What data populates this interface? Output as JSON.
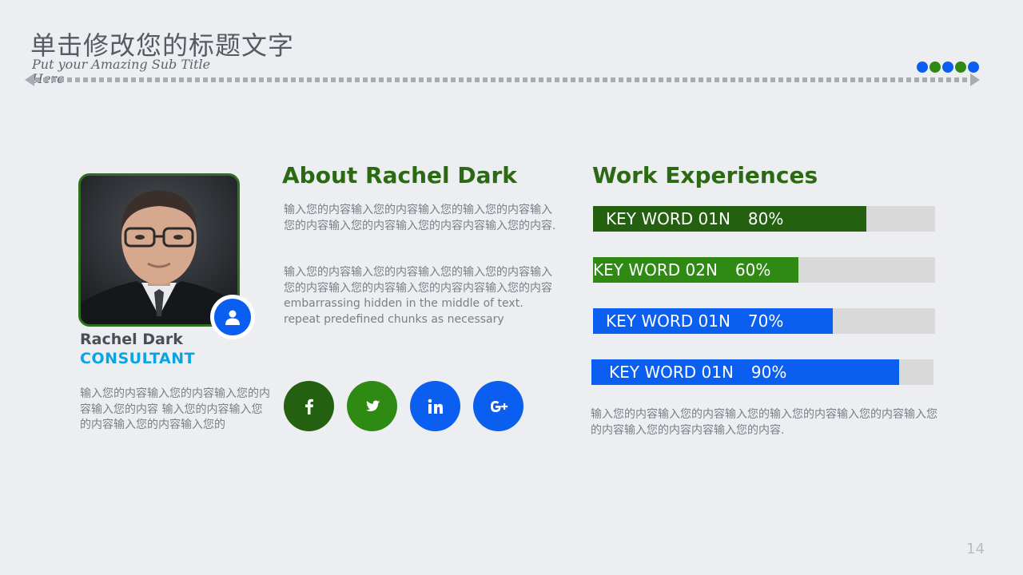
{
  "header": {
    "title": "单击修改您的标题文字",
    "subtitle": "Put your Amazing Sub Title Here"
  },
  "colors": {
    "dark_green": "#2b6a12",
    "green": "#2f8a14",
    "blue": "#0b5ff0",
    "cyan": "#0aa5e0",
    "track": "#d9d9d9",
    "divider": "#a8acb2"
  },
  "decor_dots": [
    "#0b5ff0",
    "#2f8a14",
    "#0b5ff0",
    "#2f8a14",
    "#0b5ff0"
  ],
  "profile": {
    "name": "Rachel Dark",
    "role": "CONSULTANT",
    "description": "输入您的内容输入您的内容输入您的内容输入您的内容 输入您的内容输入您的内容输入您的内容输入您的",
    "badge_icon": "user-icon"
  },
  "about": {
    "heading": "About Rachel Dark",
    "paragraph1": "输入您的内容输入您的内容输入您的输入您的内容输入您的内容输入您的内容输入您的内容内容输入您的内容.",
    "paragraph2": "输入您的内容输入您的内容输入您的输入您的内容输入您的内容输入您的内容输入您的内容内容输入您的内容 embarrassing hidden in the middle of text. repeat predefined chunks as necessary"
  },
  "social": [
    {
      "icon": "facebook-icon",
      "color": "#23600f"
    },
    {
      "icon": "twitter-icon",
      "color": "#2f8a14"
    },
    {
      "icon": "linkedin-icon",
      "color": "#0b5ff0"
    },
    {
      "icon": "google-plus-icon",
      "color": "#0b5ff0"
    }
  ],
  "work": {
    "heading": "Work Experiences",
    "bars": [
      {
        "label": "KEY WORD 01N",
        "value_text": "80%",
        "percent": 80,
        "color": "#23600f"
      },
      {
        "label": "KEY WORD 02N",
        "value_text": "60%",
        "percent": 60,
        "color": "#2f8a14"
      },
      {
        "label": "KEY WORD 01N",
        "value_text": "70%",
        "percent": 70,
        "color": "#0b5ff0"
      },
      {
        "label": "KEY WORD 01N",
        "value_text": "90%",
        "percent": 90,
        "color": "#0b5ff0"
      }
    ],
    "description": "输入您的内容输入您的内容输入您的输入您的内容输入您的内容输入您的内容输入您的内容内容输入您的内容."
  },
  "page_number": "14"
}
